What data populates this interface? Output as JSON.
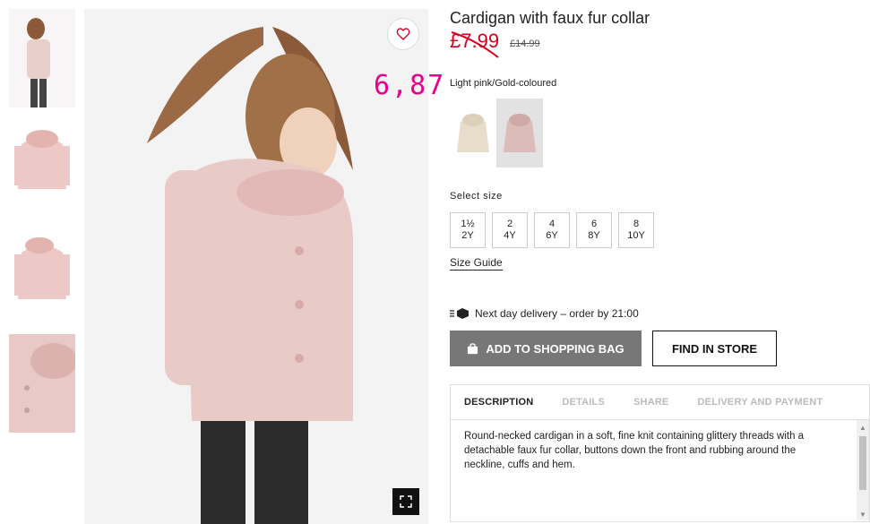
{
  "product": {
    "title": "Cardigan with faux fur collar",
    "sale_price": "£7.99",
    "old_price": "£14.99",
    "handwritten_note": "6,87",
    "color_name": "Light pink/Gold-coloured",
    "size_label": "Select size",
    "sizes": [
      {
        "top": "1½",
        "bottom": "2Y"
      },
      {
        "top": "2",
        "bottom": "4Y"
      },
      {
        "top": "4",
        "bottom": "6Y"
      },
      {
        "top": "6",
        "bottom": "8Y"
      },
      {
        "top": "8",
        "bottom": "10Y"
      }
    ],
    "size_guide": "Size Guide",
    "delivery": "Next day delivery – order by 21:00",
    "add_to_bag": "ADD TO SHOPPING BAG",
    "find_in_store": "FIND IN STORE"
  },
  "tabs": [
    "DESCRIPTION",
    "DETAILS",
    "SHARE",
    "DELIVERY AND PAYMENT"
  ],
  "description": "Round-necked cardigan in a soft, fine knit containing glittery threads with a detachable faux fur collar, buttons down the front and rubbing around the neckline, cuffs and hem.",
  "colors": {
    "sale": "#d6001c",
    "note": "#e8008a",
    "pink": "#e8c4c0",
    "bag_button": "#777777"
  }
}
